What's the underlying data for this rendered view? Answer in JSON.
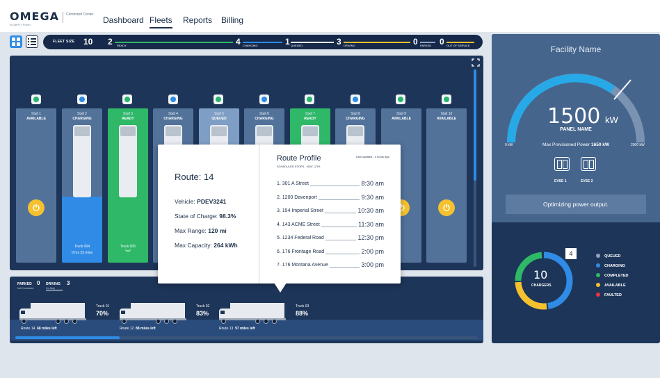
{
  "header": {
    "logo": "OMEGA",
    "logo_subtitle": "by ABPLY Power",
    "logo_caption": "Command Center",
    "nav": [
      {
        "label": "Dashboard"
      },
      {
        "label": "Fleets",
        "active": true
      },
      {
        "label": "Reports"
      },
      {
        "label": "Billing"
      }
    ]
  },
  "status_bar": {
    "fleet_size_label": "FLEET SIZE",
    "fleet_size": "10",
    "segments": [
      {
        "count": "2",
        "label": "READY",
        "color": "#2eb868"
      },
      {
        "count": "4",
        "label": "CHARGING",
        "color": "#2f8be5"
      },
      {
        "count": "1",
        "label": "QUEUED",
        "color": "#ffffff"
      },
      {
        "count": "3",
        "label": "DRIVING",
        "color": "#f5c12e"
      },
      {
        "count": "0",
        "label": "PARKED",
        "color": "#8ea3bf"
      },
      {
        "count": "0",
        "label": "OUT OF SERVICE",
        "color": "#f5c12e"
      }
    ]
  },
  "stalls": [
    {
      "title": "Stall 1",
      "status": "AVAILABLE"
    },
    {
      "title": "Stall 2",
      "status": "CHARGING",
      "truck": "Truck 004",
      "time": "0 hrs 23 mins"
    },
    {
      "title": "Stall 3",
      "status": "READY",
      "truck": "Truck 005"
    },
    {
      "title": "Stall 4",
      "status": "CHARGING"
    },
    {
      "title": "Stall 5",
      "status": "QUEUED"
    },
    {
      "title": "Stall 6",
      "status": "CHARGING"
    },
    {
      "title": "Stall 7",
      "status": "READY"
    },
    {
      "title": "Stall 8",
      "status": "CHARGING"
    },
    {
      "title": "Stall 9",
      "status": "AVAILABLE"
    },
    {
      "title": "Stall 10",
      "status": "AVAILABLE"
    }
  ],
  "popover": {
    "route_title": "Route: 14",
    "vehicle_label": "Vehicle:",
    "vehicle": "PDEV3241",
    "soc_label": "State of Charge:",
    "soc": "98.3%",
    "range_label": "Max Range:",
    "range": "120 mi",
    "capacity_label": "Max Capacity:",
    "capacity": "264 kWh",
    "profile_title": "Route Profile",
    "profile_sub": "SCHEDULED STOPS - Nov 12th",
    "updated": "Last updated - 4 hours ago",
    "stops": [
      {
        "name": "1. 301 A Street",
        "time": "8:30 am"
      },
      {
        "name": "2. 1200 Davenport",
        "time": "9:30 am"
      },
      {
        "name": "3. 154 Imperial Street",
        "time": "10:30 am"
      },
      {
        "name": "4. 143 ACME Street",
        "time": "11:30 am"
      },
      {
        "name": "5. 1234 Federal Road",
        "time": "12:30 pm"
      },
      {
        "name": "6. 176 Frontage Road",
        "time": "2:00 pm"
      },
      {
        "name": "7. 176 Montana Avenue",
        "time": "3:00 pm"
      }
    ]
  },
  "trucks_panel": {
    "parked_label": "PARKED",
    "parked": "0",
    "parked_sub": "Not Connected",
    "driving_label": "DRIVING",
    "driving": "3",
    "driving_sub": "On Duty",
    "trucks": [
      {
        "name": "Truck 01",
        "pct": "70%",
        "route": "Route 14",
        "miles": "68 miles left"
      },
      {
        "name": "Truck 02",
        "pct": "83%",
        "route": "Route 12",
        "miles": "88 miles left"
      },
      {
        "name": "Truck 03",
        "pct": "88%",
        "route": "Route 13",
        "miles": "97 miles left"
      }
    ]
  },
  "facility": {
    "title": "Facility Name",
    "power": "1500",
    "unit": "kW",
    "panel_name": "PANEL NAME",
    "min": "0 kW",
    "max": "2000 kW",
    "max_prov_label": "Max Provisioned Power",
    "max_prov": "1650 kW",
    "evse": [
      "EVSE 1",
      "EVSE 2"
    ],
    "message": "Optimizing power output.",
    "chargers": "10",
    "chargers_label": "CHARGERS",
    "queued_badge": "4",
    "legend": [
      {
        "label": "QUEUED",
        "color": "#8ea3bf"
      },
      {
        "label": "CHARGING",
        "color": "#2f8be5"
      },
      {
        "label": "COMPLETED",
        "color": "#2eb868"
      },
      {
        "label": "AVAILABLE",
        "color": "#f5c12e"
      },
      {
        "label": "FAULTED",
        "color": "#e8324a"
      }
    ]
  }
}
